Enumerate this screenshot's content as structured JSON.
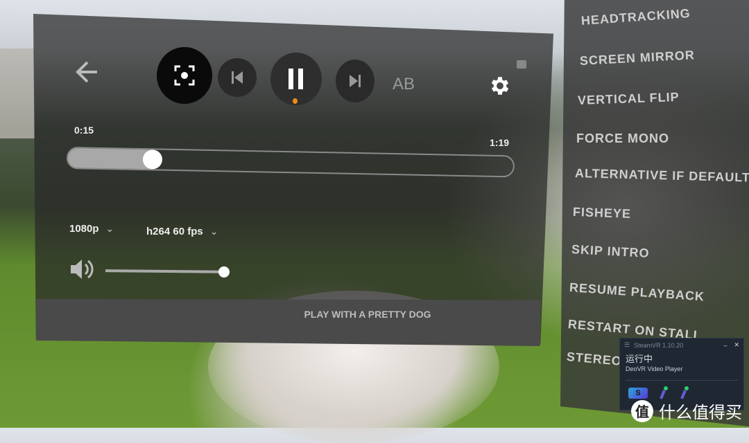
{
  "player": {
    "back_icon": "arrow-left-icon",
    "recenter_icon": "focus-recenter-icon",
    "prev_icon": "skip-previous-icon",
    "pause_icon": "pause-icon",
    "next_icon": "skip-next-icon",
    "ab_label": "AB",
    "settings_icon": "gear-icon",
    "current_time": "0:15",
    "duration": "1:19",
    "progress_fraction": 0.19,
    "quality": "1080p",
    "codec": "h264 60 fps",
    "volume_fraction": 0.96,
    "title": "PLAY WITH A PRETTY DOG",
    "accent_color": "#f08a1c"
  },
  "settings_menu": {
    "items": [
      "HEADTRACKING",
      "SCREEN MIRROR",
      "VERTICAL FLIP",
      "FORCE MONO",
      "ALTERNATIVE IF DEFAULT",
      "FISHEYE",
      "SKIP INTRO",
      "RESUME PLAYBACK",
      "RESTART ON STALL",
      "STEREO"
    ]
  },
  "steamvr": {
    "title": "SteamVR 1.10.20",
    "status": "运行中",
    "app": "DeoVR Video Player",
    "logo_letter": "S"
  },
  "watermark": {
    "logo": "值",
    "text": "什么值得买"
  }
}
